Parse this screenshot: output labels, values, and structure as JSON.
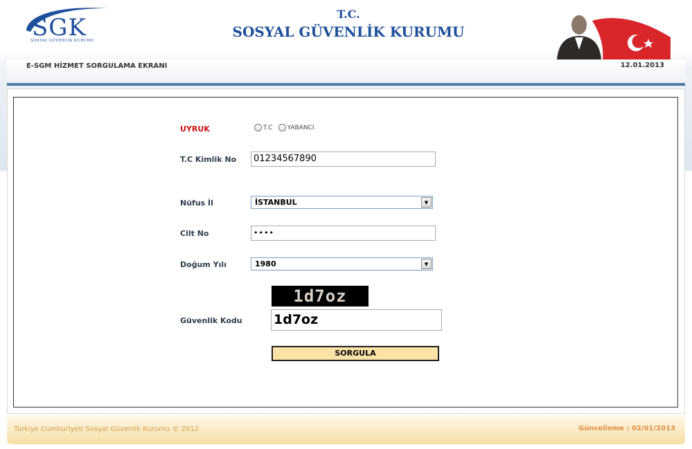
{
  "header": {
    "logo_text": "SGK",
    "logo_sub": "SOSYAL GÜVENLİK KURUMU",
    "title_tc": "T.C.",
    "title_main": "SOSYAL GÜVENLİK KURUMU"
  },
  "topbar": {
    "screen_title": "E-SGM HİZMET SORGULAMA EKRANI",
    "date": "12.01.2013"
  },
  "form": {
    "uyruk_label": "UYRUK",
    "uyruk_options": [
      "T.C",
      "YABANCI"
    ],
    "tc_label": "T.C Kimlik No",
    "tc_value": "01234567890",
    "nufus_label": "Nüfus İl",
    "nufus_value": "İSTANBUL",
    "cilt_label": "Cilt No",
    "cilt_value": "••••",
    "dogum_label": "Doğum Yılı",
    "dogum_value": "1980",
    "captcha_image_text": "1d7oz",
    "guvenlik_label": "Güvenlik Kodu",
    "guvenlik_value": "1d7oz",
    "submit_label": "SORGULA"
  },
  "footer": {
    "copyright": "Türkiye Cumhuriyeti Sosyal Güvenlik Kurumu © 2012",
    "update": "Güncelleme : 02/01/2013"
  },
  "colors": {
    "brand_blue": "#1d4f9c",
    "label_red": "#cc1111",
    "button_bg": "#fbe3a8",
    "footer_text": "#e0904a",
    "topbar_rule": "#4f79a8"
  }
}
